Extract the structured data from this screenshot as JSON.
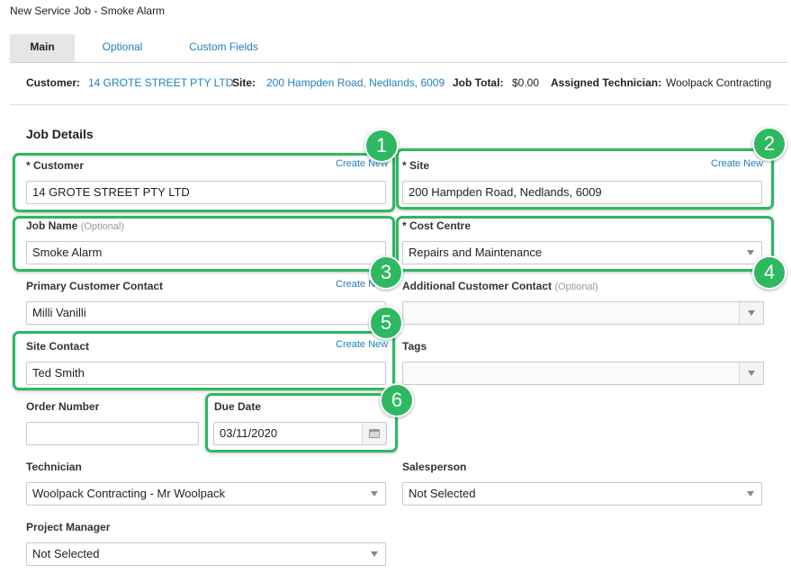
{
  "page": {
    "title": "New Service Job - Smoke Alarm"
  },
  "tabs": [
    {
      "label": "Main"
    },
    {
      "label": "Optional"
    },
    {
      "label": "Custom Fields"
    }
  ],
  "summary": {
    "customer_label": "Customer:",
    "customer_value": "14 GROTE STREET PTY LTD",
    "site_label": "Site:",
    "site_value": "200 Hampden Road, Nedlands, 6009",
    "job_total_label": "Job Total:",
    "job_total_value": "$0.00",
    "technician_label": "Assigned Technician:",
    "technician_value": "Woolpack Contracting"
  },
  "section": {
    "title": "Job Details"
  },
  "create_new": "Create New",
  "fields": {
    "customer": {
      "label": "* Customer",
      "value": "14 GROTE STREET PTY LTD"
    },
    "site": {
      "label": "* Site",
      "value": "200 Hampden Road, Nedlands, 6009"
    },
    "job_name": {
      "label": "Job Name",
      "optional": "(Optional)",
      "value": "Smoke Alarm"
    },
    "cost_centre": {
      "label": "* Cost Centre",
      "value": "Repairs and Maintenance"
    },
    "primary_contact": {
      "label": "Primary Customer Contact",
      "value": "Milli Vanilli"
    },
    "additional_contact": {
      "label": "Additional Customer Contact",
      "optional": "(Optional)",
      "value": ""
    },
    "site_contact": {
      "label": "Site Contact",
      "value": "Ted Smith"
    },
    "tags": {
      "label": "Tags",
      "value": ""
    },
    "order_number": {
      "label": "Order Number",
      "value": ""
    },
    "due_date": {
      "label": "Due Date",
      "value": "03/11/2020"
    },
    "technician": {
      "label": "Technician",
      "value": "Woolpack Contracting - Mr Woolpack"
    },
    "salesperson": {
      "label": "Salesperson",
      "value": "Not Selected"
    },
    "project_manager": {
      "label": "Project Manager",
      "value": "Not Selected"
    }
  },
  "badges": [
    "1",
    "2",
    "3",
    "4",
    "5",
    "6"
  ],
  "colors": {
    "highlight": "#2eb862",
    "link": "#1f7fbf",
    "active_tab": "#e6e6e6"
  }
}
